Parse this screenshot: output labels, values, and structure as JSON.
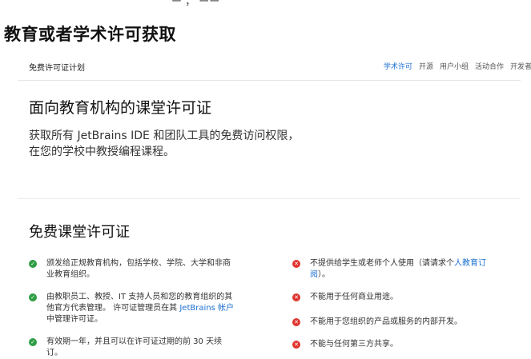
{
  "top_cut_text": "ー ， ーー",
  "page_heading": "教育或者学术许可获取",
  "subnav": {
    "brand": "免费许可证计划",
    "links": [
      "学术许可",
      "开源",
      "用户小组",
      "活动合作",
      "开发者"
    ]
  },
  "hero": {
    "title": "面向教育机构的课堂许可证",
    "desc_line1": "获取所有 JetBrains IDE 和团队工具的免费访问权限，",
    "desc_line2": "在您的学校中教授编程课程。"
  },
  "section": {
    "title": "免费课堂许可证",
    "pros": [
      {
        "line1": "颁发给正规教育机构，包括学校、学院、大学和非商",
        "line2": "业教育组织。"
      },
      {
        "line1": "由教职员工、教授、IT 支持人员和您的教育组织的其",
        "line2_pre": "他官方代表管理。 许可证管理员在其 ",
        "line2_link": "JetBrains 帐户",
        "line3": "中管理许可证。"
      },
      {
        "line1": "有效期一年，并且可以在许可证过期的前 30 天续订。"
      }
    ],
    "cons": [
      {
        "line1_pre": "不提供给学生或老师个人使用（请请求个",
        "line1_link": "人教育订",
        "line2_link": "阅",
        "line2_post": "）。"
      },
      {
        "line1": "不能用于任何商业用途。"
      },
      {
        "line1": "不能用于您组织的产品或服务的内部开发。"
      },
      {
        "line1": "不能与任何第三方共享。"
      }
    ]
  },
  "colors": {
    "accent": "#1c6fd1",
    "ok": "#2e9d44",
    "no": "#e0352f"
  }
}
